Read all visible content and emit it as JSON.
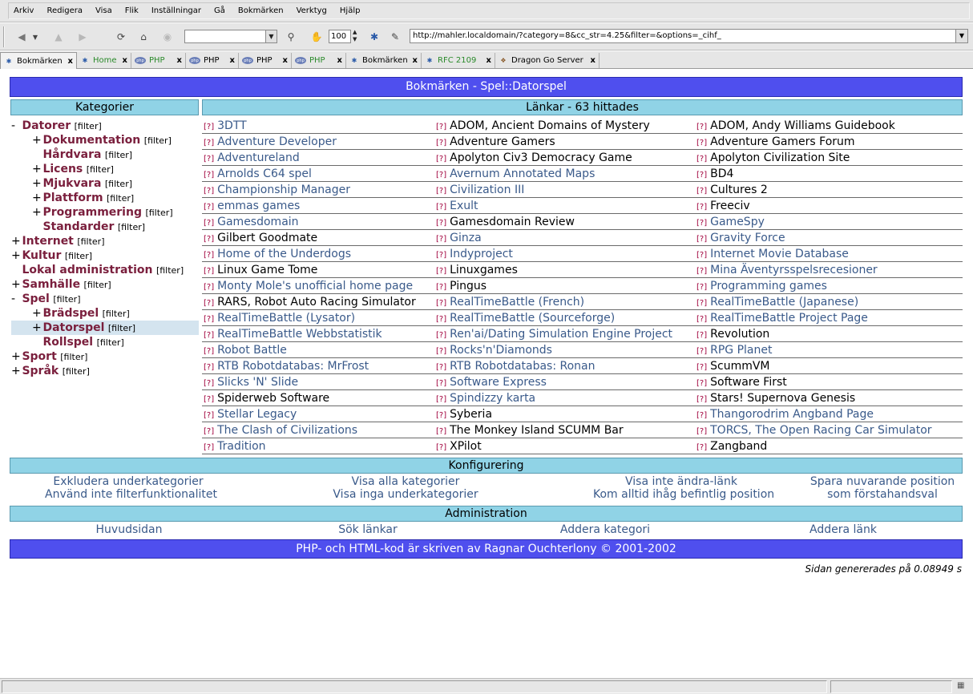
{
  "menubar": {
    "items": [
      "Arkiv",
      "Redigera",
      "Visa",
      "Flik",
      "Inställningar",
      "Gå",
      "Bokmärken",
      "Verktyg",
      "Hjälp"
    ]
  },
  "toolbar": {
    "zoom": "100",
    "url": "http://mahler.localdomain/?category=8&cc_str=4.25&filter=&options=_cihf_"
  },
  "tabs": [
    {
      "label": "Bokmärken",
      "icon": "moz",
      "active": true,
      "green": false
    },
    {
      "label": "Home",
      "icon": "moz",
      "active": false,
      "green": true
    },
    {
      "label": "PHP",
      "icon": "php",
      "active": false,
      "green": true
    },
    {
      "label": "PHP",
      "icon": "php",
      "active": false,
      "green": false
    },
    {
      "label": "PHP",
      "icon": "php",
      "active": false,
      "green": false
    },
    {
      "label": "PHP",
      "icon": "php",
      "active": false,
      "green": true
    },
    {
      "label": "Bokmärken",
      "icon": "moz",
      "active": false,
      "green": false
    },
    {
      "label": "RFC 2109",
      "icon": "moz",
      "active": false,
      "green": true
    },
    {
      "label": "Dragon Go Server",
      "icon": "go",
      "active": false,
      "green": false
    }
  ],
  "tab_close": "x",
  "page": {
    "title": "Bokmärken - Spel::Datorspel",
    "categories_header": "Kategorier",
    "links_header": "Länkar - 63 hittades",
    "filter_label": "[filter]",
    "link_marker": "[?]",
    "config_header": "Konfigurering",
    "admin_header": "Administration",
    "footer": "PHP- och HTML-kod är skriven av Ragnar Ouchterlony © 2001-2002",
    "generated": "Sidan genererades på 0.08949 s"
  },
  "categories": [
    {
      "toggle": "-",
      "label": "Datorer",
      "level": 0,
      "selected": false
    },
    {
      "toggle": "+",
      "label": "Dokumentation",
      "level": 1,
      "selected": false
    },
    {
      "toggle": "",
      "label": "Hårdvara",
      "level": 1,
      "selected": false
    },
    {
      "toggle": "+",
      "label": "Licens",
      "level": 1,
      "selected": false
    },
    {
      "toggle": "+",
      "label": "Mjukvara",
      "level": 1,
      "selected": false
    },
    {
      "toggle": "+",
      "label": "Plattform",
      "level": 1,
      "selected": false
    },
    {
      "toggle": "+",
      "label": "Programmering",
      "level": 1,
      "selected": false
    },
    {
      "toggle": "",
      "label": "Standarder",
      "level": 1,
      "selected": false
    },
    {
      "toggle": "+",
      "label": "Internet",
      "level": 0,
      "selected": false
    },
    {
      "toggle": "+",
      "label": "Kultur",
      "level": 0,
      "selected": false
    },
    {
      "toggle": "",
      "label": "Lokal administration",
      "level": 0,
      "selected": false
    },
    {
      "toggle": "+",
      "label": "Samhälle",
      "level": 0,
      "selected": false
    },
    {
      "toggle": "-",
      "label": "Spel",
      "level": 0,
      "selected": false
    },
    {
      "toggle": "+",
      "label": "Brädspel",
      "level": 1,
      "selected": false
    },
    {
      "toggle": "+",
      "label": "Datorspel",
      "level": 1,
      "selected": true
    },
    {
      "toggle": "",
      "label": "Rollspel",
      "level": 1,
      "selected": false
    },
    {
      "toggle": "+",
      "label": "Sport",
      "level": 0,
      "selected": false
    },
    {
      "toggle": "+",
      "label": "Språk",
      "level": 0,
      "selected": false
    }
  ],
  "links": [
    [
      {
        "t": "3DTT",
        "v": 0
      },
      {
        "t": "ADOM, Ancient Domains of Mystery",
        "v": 1
      },
      {
        "t": "ADOM, Andy Williams Guidebook",
        "v": 1
      }
    ],
    [
      {
        "t": "Adventure Developer",
        "v": 0
      },
      {
        "t": "Adventure Gamers",
        "v": 1
      },
      {
        "t": "Adventure Gamers Forum",
        "v": 1
      }
    ],
    [
      {
        "t": "Adventureland",
        "v": 0
      },
      {
        "t": "Apolyton Civ3 Democracy Game",
        "v": 1
      },
      {
        "t": "Apolyton Civilization Site",
        "v": 1
      }
    ],
    [
      {
        "t": "Arnolds C64 spel",
        "v": 0
      },
      {
        "t": "Avernum Annotated Maps",
        "v": 0
      },
      {
        "t": "BD4",
        "v": 1
      }
    ],
    [
      {
        "t": "Championship Manager",
        "v": 0
      },
      {
        "t": "Civilization III",
        "v": 0
      },
      {
        "t": "Cultures 2",
        "v": 1
      }
    ],
    [
      {
        "t": "emmas games",
        "v": 0
      },
      {
        "t": "Exult",
        "v": 0
      },
      {
        "t": "Freeciv",
        "v": 1
      }
    ],
    [
      {
        "t": "Gamesdomain",
        "v": 0
      },
      {
        "t": "Gamesdomain Review",
        "v": 1
      },
      {
        "t": "GameSpy",
        "v": 0
      }
    ],
    [
      {
        "t": "Gilbert Goodmate",
        "v": 1
      },
      {
        "t": "Ginza",
        "v": 0
      },
      {
        "t": "Gravity Force",
        "v": 0
      }
    ],
    [
      {
        "t": "Home of the Underdogs",
        "v": 0
      },
      {
        "t": "Indyproject",
        "v": 0
      },
      {
        "t": "Internet Movie Database",
        "v": 0
      }
    ],
    [
      {
        "t": "Linux Game Tome",
        "v": 1
      },
      {
        "t": "Linuxgames",
        "v": 1
      },
      {
        "t": "Mina Äventyrsspelsrecesioner",
        "v": 0
      }
    ],
    [
      {
        "t": "Monty Mole's unofficial home page",
        "v": 0
      },
      {
        "t": "Pingus",
        "v": 1
      },
      {
        "t": "Programming games",
        "v": 0
      }
    ],
    [
      {
        "t": "RARS, Robot Auto Racing Simulator",
        "v": 1
      },
      {
        "t": "RealTimeBattle (French)",
        "v": 0
      },
      {
        "t": "RealTimeBattle (Japanese)",
        "v": 0
      }
    ],
    [
      {
        "t": "RealTimeBattle (Lysator)",
        "v": 0
      },
      {
        "t": "RealTimeBattle (Sourceforge)",
        "v": 0
      },
      {
        "t": "RealTimeBattle Project Page",
        "v": 0
      }
    ],
    [
      {
        "t": "RealTimeBattle Webbstatistik",
        "v": 0
      },
      {
        "t": "Ren'ai/Dating Simulation Engine Project",
        "v": 0
      },
      {
        "t": "Revolution",
        "v": 1
      }
    ],
    [
      {
        "t": "Robot Battle",
        "v": 0
      },
      {
        "t": "Rocks'n'Diamonds",
        "v": 0
      },
      {
        "t": "RPG Planet",
        "v": 0
      }
    ],
    [
      {
        "t": "RTB Robotdatabas: MrFrost",
        "v": 0
      },
      {
        "t": "RTB Robotdatabas: Ronan",
        "v": 0
      },
      {
        "t": "ScummVM",
        "v": 1
      }
    ],
    [
      {
        "t": "Slicks 'N' Slide",
        "v": 0
      },
      {
        "t": "Software Express",
        "v": 0
      },
      {
        "t": "Software First",
        "v": 1
      }
    ],
    [
      {
        "t": "Spiderweb Software",
        "v": 1
      },
      {
        "t": "Spindizzy karta",
        "v": 0
      },
      {
        "t": "Stars! Supernova Genesis",
        "v": 1
      }
    ],
    [
      {
        "t": "Stellar Legacy",
        "v": 0
      },
      {
        "t": "Syberia",
        "v": 1
      },
      {
        "t": "Thangorodrim Angband Page",
        "v": 0
      }
    ],
    [
      {
        "t": "The Clash of Civilizations",
        "v": 0
      },
      {
        "t": "The Monkey Island SCUMM Bar",
        "v": 1
      },
      {
        "t": "TORCS, The Open Racing Car Simulator",
        "v": 0
      }
    ],
    [
      {
        "t": "Tradition",
        "v": 0
      },
      {
        "t": "XPilot",
        "v": 1
      },
      {
        "t": "Zangband",
        "v": 1
      }
    ]
  ],
  "config": {
    "exclude_sub": "Exkludera underkategorier",
    "no_filter": "Använd inte filterfunktionalitet",
    "show_all": "Visa alla kategorier",
    "show_no_sub": "Visa inga underkategorier",
    "hide_edit": "Visa inte ändra-länk",
    "remember": "Kom alltid ihåg befintlig position",
    "save_pos": "Spara nuvarande position som förstahandsval"
  },
  "admin": {
    "home": "Huvudsidan",
    "search": "Sök länkar",
    "add_cat": "Addera kategori",
    "add_link": "Addera länk"
  },
  "colors": {
    "title_bar": "#4f4fee",
    "header_bar": "#90d3e6",
    "category_text": "#7a1f3d",
    "link_text": "#3a5a8a",
    "marker": "#a0003c"
  }
}
